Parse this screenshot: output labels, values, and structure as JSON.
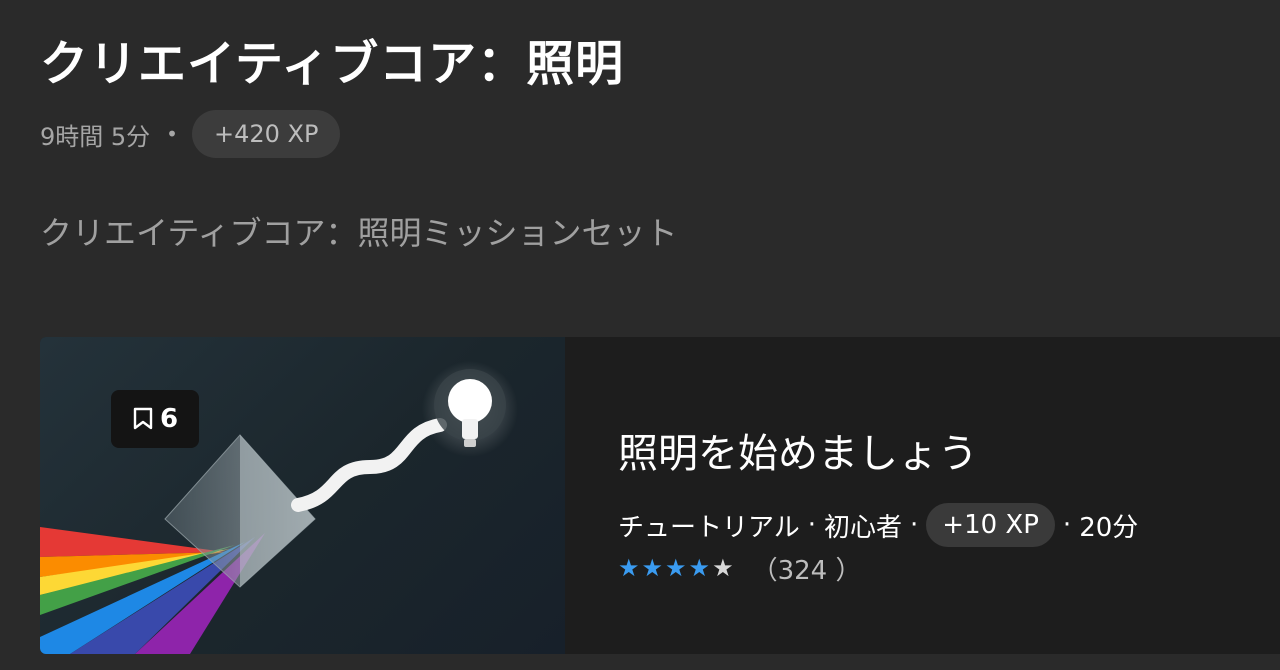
{
  "course": {
    "title": "クリエイティブコア：照明",
    "duration": "9時間 5分",
    "dot": "•",
    "xp": "+420 XP",
    "subtitle": "クリエイティブコア：照明ミッションセット"
  },
  "card": {
    "bookmark_count": "6",
    "title": "照明を始めましょう",
    "type": "チュートリアル",
    "level": "初心者",
    "xp": "+10 XP",
    "duration": "20分",
    "separator": "·",
    "rating_stars": 4,
    "rating_max": 5,
    "rating_count": "（324 ）",
    "icons": {
      "bookmark": "bookmark-icon",
      "star": "star-icon"
    },
    "colors": {
      "star_full": "#3a9bf0",
      "star_empty": "#d8d8d8"
    }
  }
}
